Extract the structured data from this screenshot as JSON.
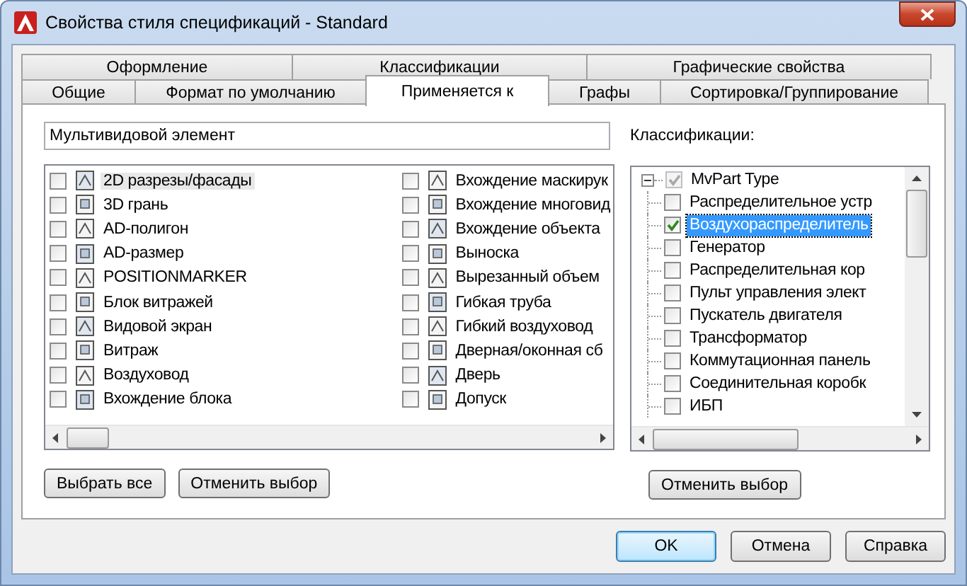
{
  "window": {
    "title": "Свойства стиля спецификаций - Standard"
  },
  "tabs": [
    [
      {
        "label": "Оформление",
        "selected": false
      },
      {
        "label": "Классификации",
        "selected": false
      },
      {
        "label": "Графические свойства",
        "selected": false
      }
    ],
    [
      {
        "label": "Общие",
        "selected": false
      },
      {
        "label": "Формат по умолчанию",
        "selected": false
      },
      {
        "label": "Применяется к",
        "selected": true
      },
      {
        "label": "Графы",
        "selected": false
      },
      {
        "label": "Сортировка/Группирование",
        "selected": false
      }
    ]
  ],
  "name_field": {
    "value": "Мультивидовой элемент"
  },
  "objects": {
    "columns": [
      [
        {
          "label": "2D разрезы/фасады",
          "checked": false,
          "selected": true
        },
        {
          "label": "3D грань",
          "checked": false,
          "selected": false
        },
        {
          "label": "AD-полигон",
          "checked": false,
          "selected": false
        },
        {
          "label": "AD-размер",
          "checked": false,
          "selected": false
        },
        {
          "label": "POSITIONMARKER",
          "checked": false,
          "selected": false
        },
        {
          "label": "Блок витражей",
          "checked": false,
          "selected": false
        },
        {
          "label": "Видовой экран",
          "checked": false,
          "selected": false
        },
        {
          "label": "Витраж",
          "checked": false,
          "selected": false
        },
        {
          "label": "Воздуховод",
          "checked": false,
          "selected": false
        },
        {
          "label": "Вхождение блока",
          "checked": false,
          "selected": false
        }
      ],
      [
        {
          "label": "Вхождение маскирук",
          "checked": false,
          "selected": false
        },
        {
          "label": "Вхождение многовид",
          "checked": false,
          "selected": false
        },
        {
          "label": "Вхождение объекта",
          "checked": false,
          "selected": false
        },
        {
          "label": "Выноска",
          "checked": false,
          "selected": false
        },
        {
          "label": "Вырезанный объем",
          "checked": false,
          "selected": false
        },
        {
          "label": "Гибкая труба",
          "checked": false,
          "selected": false
        },
        {
          "label": "Гибкий воздуховод",
          "checked": false,
          "selected": false
        },
        {
          "label": "Дверная/оконная сб",
          "checked": false,
          "selected": false
        },
        {
          "label": "Дверь",
          "checked": false,
          "selected": false
        },
        {
          "label": "Допуск",
          "checked": false,
          "selected": false
        }
      ]
    ],
    "buttons": [
      "Выбрать все",
      "Отменить выбор"
    ]
  },
  "classifications": {
    "label": "Классификации:",
    "tree": {
      "label": "MvPart Type",
      "checked": true,
      "disabled": true,
      "expanded": true,
      "selected": false,
      "children": [
        {
          "label": "Распределительное устр",
          "checked": false,
          "disabled": false,
          "selected": false
        },
        {
          "label": "Воздухораспределитель",
          "checked": true,
          "disabled": false,
          "selected": true
        },
        {
          "label": "Генератор",
          "checked": false,
          "disabled": false,
          "selected": false
        },
        {
          "label": "Распределительная кор",
          "checked": false,
          "disabled": false,
          "selected": false
        },
        {
          "label": "Пульт управления элект",
          "checked": false,
          "disabled": false,
          "selected": false
        },
        {
          "label": "Пускатель двигателя",
          "checked": false,
          "disabled": false,
          "selected": false
        },
        {
          "label": "Трансформатор",
          "checked": false,
          "disabled": false,
          "selected": false
        },
        {
          "label": "Коммутационная панель",
          "checked": false,
          "disabled": false,
          "selected": false
        },
        {
          "label": "Соединительная коробк",
          "checked": false,
          "disabled": false,
          "selected": false
        },
        {
          "label": "ИБП",
          "checked": false,
          "disabled": false,
          "selected": false
        }
      ]
    },
    "button": "Отменить выбор"
  },
  "dialog_buttons": [
    {
      "label": "OK",
      "default": true
    },
    {
      "label": "Отмена",
      "default": false
    },
    {
      "label": "Справка",
      "default": false
    }
  ]
}
